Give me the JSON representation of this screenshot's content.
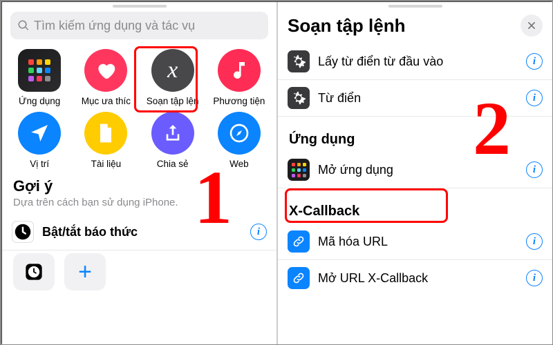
{
  "left": {
    "search_placeholder": "Tìm kiếm ứng dụng và tác vụ",
    "categories": [
      {
        "label": "Ứng dụng"
      },
      {
        "label": "Mục ưa thíc"
      },
      {
        "label": "Soạn tập lện"
      },
      {
        "label": "Phương tiện"
      },
      {
        "label": "Vị trí"
      },
      {
        "label": "Tài liệu"
      },
      {
        "label": "Chia sẻ"
      },
      {
        "label": "Web"
      }
    ],
    "suggestions": {
      "title": "Gợi ý",
      "subtitle": "Dựa trên cách bạn sử dụng iPhone.",
      "item_label": "Bật/tắt báo thức"
    },
    "annotation_number": "1"
  },
  "right": {
    "title": "Soạn tập lệnh",
    "top_items": [
      {
        "label": "Lấy từ điển từ đầu vào"
      },
      {
        "label": "Từ điển"
      }
    ],
    "group_apps": {
      "title": "Ứng dụng",
      "items": [
        {
          "label": "Mở ứng dụng"
        }
      ]
    },
    "group_xcb": {
      "title": "X-Callback",
      "items": [
        {
          "label": "Mã hóa URL"
        },
        {
          "label": "Mở URL X-Callback"
        }
      ]
    },
    "annotation_number": "2"
  },
  "colors": {
    "dot_palette": [
      "#ff453a",
      "#ff9f0a",
      "#ffd60a",
      "#30d158",
      "#64d2ff",
      "#0a84ff",
      "#bf5af2",
      "#ff375f",
      "#8e8e93"
    ]
  }
}
